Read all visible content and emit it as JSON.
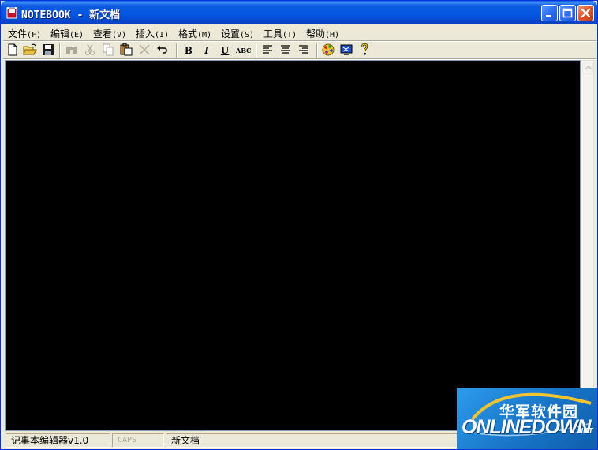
{
  "window": {
    "title": "NOTEBOOK - 新文档"
  },
  "menu": [
    {
      "label": "文件",
      "accel": "(F)"
    },
    {
      "label": "编辑",
      "accel": "(E)"
    },
    {
      "label": "查看",
      "accel": "(V)"
    },
    {
      "label": "插入",
      "accel": "(I)"
    },
    {
      "label": "格式",
      "accel": "(M)"
    },
    {
      "label": "设置",
      "accel": "(S)"
    },
    {
      "label": "工具",
      "accel": "(T)"
    },
    {
      "label": "帮助",
      "accel": "(H)"
    }
  ],
  "toolbar": {
    "icons": [
      "new-file-icon",
      "open-folder-icon",
      "save-icon",
      "find-icon",
      "cut-icon",
      "copy-icon",
      "paste-icon",
      "delete-icon",
      "undo-icon",
      "bold-icon",
      "italic-icon",
      "underline-icon",
      "strikethrough-icon",
      "align-left-icon",
      "align-center-icon",
      "align-right-icon",
      "palette-icon",
      "options-icon",
      "help-icon"
    ],
    "bold_label": "B",
    "italic_label": "I",
    "underline_label": "U",
    "strike_label": "ABC"
  },
  "editor": {
    "background": "#000000",
    "content": ""
  },
  "statusbar": {
    "app_name": "记事本编辑器v1.0",
    "caps": "CAPS",
    "doc_name": "新文档"
  },
  "watermark": {
    "cn": "华军软件园",
    "en": "ONLINEDOWN",
    "suffix": ".NET"
  },
  "colors": {
    "titlebar": "#0456e0",
    "chrome": "#ece9d8",
    "close_button": "#e05a33"
  }
}
